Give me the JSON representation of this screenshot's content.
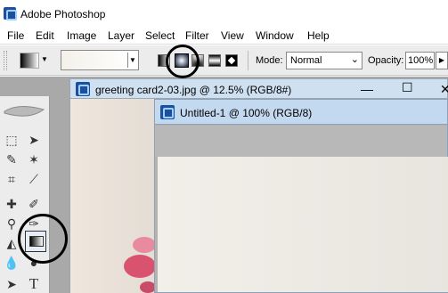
{
  "app": {
    "title": "Adobe Photoshop"
  },
  "menu": [
    "File",
    "Edit",
    "Image",
    "Layer",
    "Select",
    "Filter",
    "View",
    "Window",
    "Help"
  ],
  "options": {
    "mode_label": "Mode:",
    "mode_value": "Normal",
    "opacity_label": "Opacity:",
    "opacity_value": "100%"
  },
  "documents": {
    "background_title": "greeting card2-03.jpg @ 12.5% (RGB/8#)",
    "foreground_title": "Untitled-1 @ 100% (RGB/8)"
  },
  "toolbox": {
    "text_tool_label": "T"
  },
  "colors": {
    "annotation": "#000000",
    "titlebar_active": "#c3d9ef",
    "flower_pink": "#e88aa0"
  },
  "icons": {
    "app": "photoshop-icon",
    "gradient_types": [
      "linear-gradient-icon",
      "radial-gradient-icon",
      "angle-gradient-icon",
      "reflected-gradient-icon",
      "diamond-gradient-icon"
    ]
  }
}
